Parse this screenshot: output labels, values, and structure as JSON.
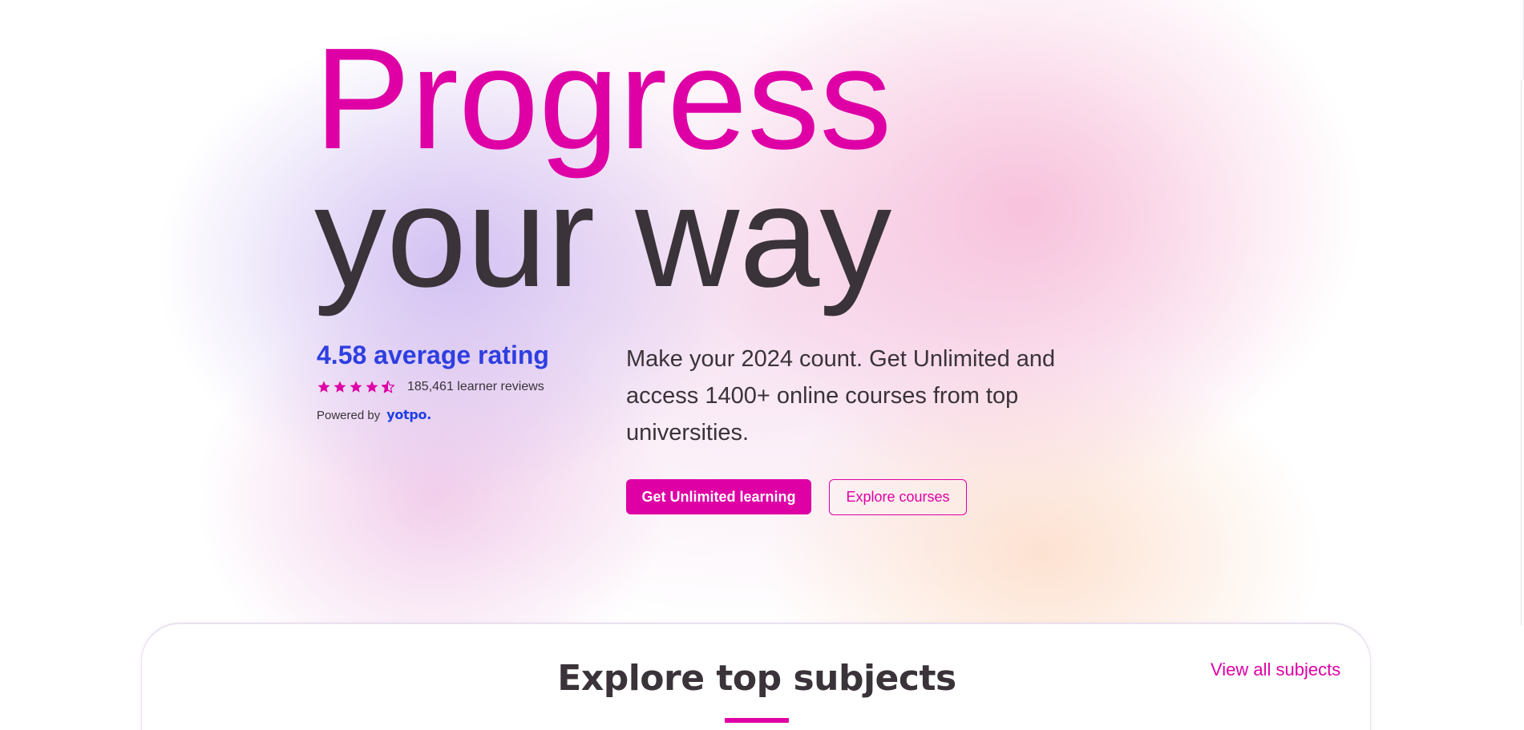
{
  "hero": {
    "title_line_1": "Progress",
    "title_line_2": "your way",
    "title_line_1_color": "#de00a5",
    "title_line_2_color": "#3a3339"
  },
  "rating": {
    "title": "4.58 average rating",
    "stars_value": 4.5,
    "stars_max": 5,
    "reviews": "185,461 learner reviews",
    "powered_by": "Powered by",
    "provider_logo": "yotpo."
  },
  "intro": {
    "text": "Make your 2024 count. Get Unlimited and access 1400+ online courses from top universities."
  },
  "actions": {
    "primary_label": "Get Unlimited learning",
    "secondary_label": "Explore courses"
  },
  "subjects": {
    "title": "Explore top subjects",
    "view_all_label": "View all subjects"
  },
  "colors": {
    "brand_pink": "#de00a5",
    "rating_blue": "#2e3fe0",
    "text_dark": "#3a3339"
  },
  "icons": {
    "star": "star-icon",
    "half_star": "half-star-icon"
  }
}
